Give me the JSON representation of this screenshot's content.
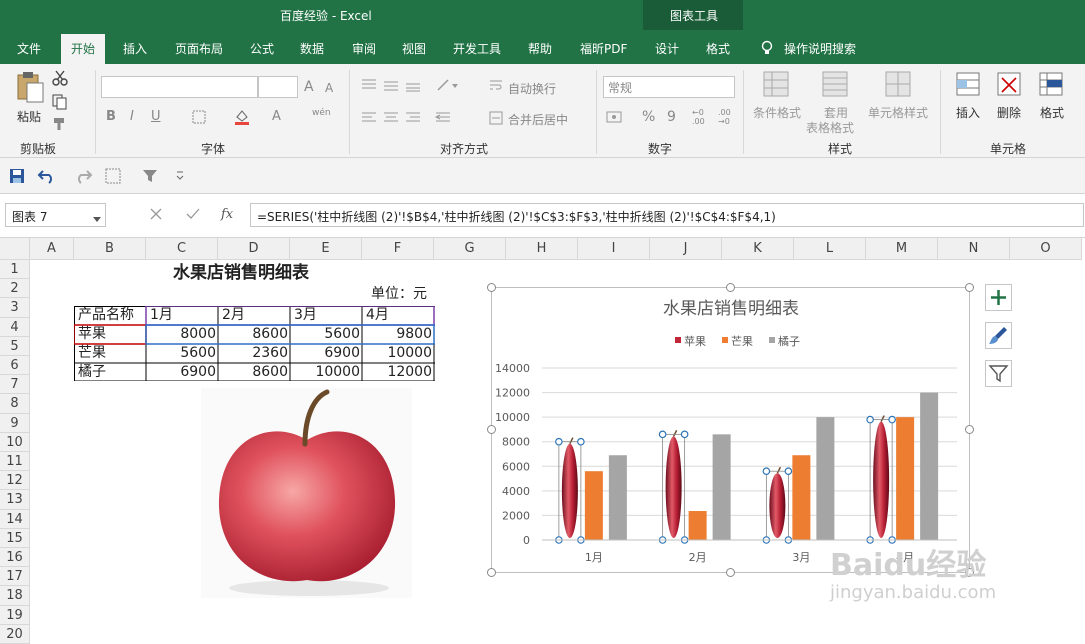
{
  "window": {
    "title": "百度经验  -  Excel",
    "context_title": "图表工具"
  },
  "tabs": [
    "文件",
    "开始",
    "插入",
    "页面布局",
    "公式",
    "数据",
    "审阅",
    "视图",
    "开发工具",
    "帮助",
    "福昕PDF",
    "设计",
    "格式"
  ],
  "tell_me": "操作说明搜索",
  "ribbon": {
    "clipboard": {
      "paste": "粘贴",
      "label": "剪贴板"
    },
    "font": {
      "label": "字体",
      "bold": "B",
      "italic": "I",
      "underline": "U",
      "grow": "A",
      "shrink": "A",
      "color_a": "A",
      "wen": "wén"
    },
    "alignment": {
      "label": "对齐方式",
      "wrap": "自动换行",
      "merge": "合并后居中"
    },
    "number": {
      "label": "数字",
      "format": "常规",
      "percent": "%",
      "comma": "9",
      "inc": "←0 .00",
      "dec": ".00 →0"
    },
    "styles": {
      "label": "样式",
      "conditional": "条件格式",
      "table_format_1": "套用",
      "table_format_2": "表格格式",
      "cell_styles": "单元格样式"
    },
    "cells": {
      "label": "单元格",
      "insert": "插入",
      "delete": "删除",
      "format": "格式"
    }
  },
  "formula_bar": {
    "name_box": "图表 7",
    "fx": "fx",
    "formula": "=SERIES('柱中折线图 (2)'!$B$4,'柱中折线图 (2)'!$C$3:$F$3,'柱中折线图 (2)'!$C$4:$F$4,1)"
  },
  "columns": [
    "A",
    "B",
    "C",
    "D",
    "E",
    "F",
    "G",
    "H",
    "I",
    "J",
    "K",
    "L",
    "M",
    "N",
    "O"
  ],
  "rows": [
    "1",
    "2",
    "3",
    "4",
    "5",
    "6",
    "7",
    "8",
    "9",
    "10",
    "11",
    "12",
    "13",
    "14",
    "15",
    "16",
    "17",
    "18",
    "19",
    "20"
  ],
  "sheet": {
    "title": "水果店销售明细表",
    "unit": "单位：元",
    "headers": [
      "产品名称",
      "1月",
      "2月",
      "3月",
      "4月"
    ],
    "data": [
      {
        "name": "苹果",
        "values": [
          "8000",
          "8600",
          "5600",
          "9800"
        ]
      },
      {
        "name": "芒果",
        "values": [
          "5600",
          "2360",
          "6900",
          "10000"
        ]
      },
      {
        "name": "橘子",
        "values": [
          "6900",
          "8600",
          "10000",
          "12000"
        ]
      }
    ]
  },
  "colors": {
    "excel_green": "#217346",
    "apple": "#c0283a",
    "mango": "#ed7d31",
    "orange": "#a5a5a5"
  },
  "chart_data": {
    "type": "bar",
    "title": "水果店销售明细表",
    "categories": [
      "1月",
      "2月",
      "3月",
      "4月"
    ],
    "series": [
      {
        "name": "苹果",
        "values": [
          8000,
          8600,
          5600,
          9800
        ],
        "color": "#c0283a"
      },
      {
        "name": "芒果",
        "values": [
          5600,
          2360,
          6900,
          10000
        ],
        "color": "#ed7d31"
      },
      {
        "name": "橘子",
        "values": [
          6900,
          8600,
          10000,
          12000
        ],
        "color": "#a5a5a5"
      }
    ],
    "ylim": [
      0,
      14000
    ],
    "yticks": [
      0,
      2000,
      4000,
      6000,
      8000,
      10000,
      12000,
      14000
    ],
    "legend": "top",
    "grid": true
  },
  "watermark": {
    "brand": "Baidu经验",
    "url": "jingyan.baidu.com"
  }
}
